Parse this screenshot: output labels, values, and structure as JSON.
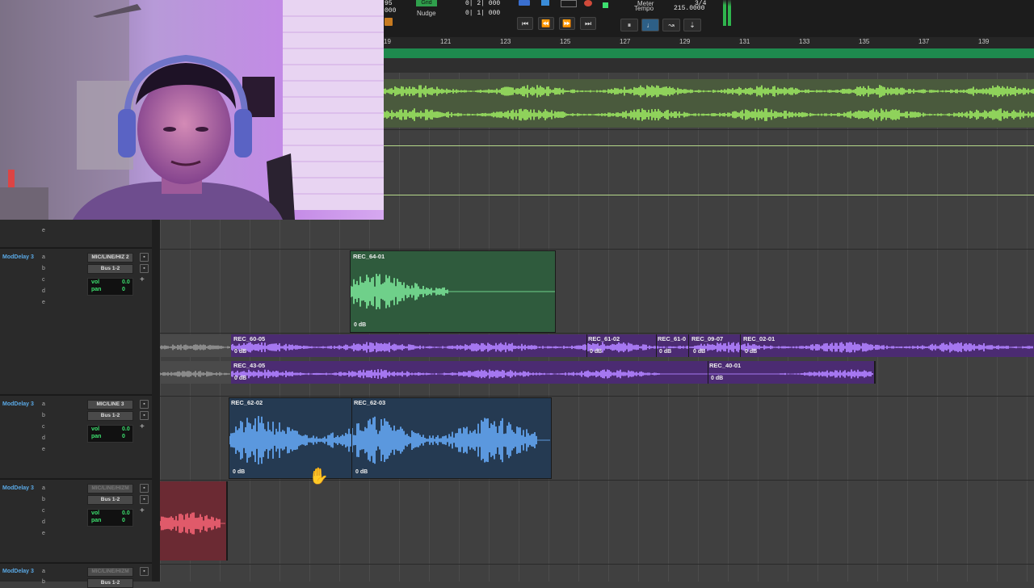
{
  "transport": {
    "counter_top": "95",
    "counter_bottom": "000",
    "grid_label": "Grid",
    "grid_value": "0| 2| 000",
    "nudge_label": "Nudge",
    "nudge_value": "0| 1| 000",
    "meter_label": "Meter",
    "tempo_label": "Tempo",
    "meter_value": "3/4",
    "tempo_value": "215.0000"
  },
  "ruler": {
    "bars": [
      "19",
      "121",
      "123",
      "125",
      "127",
      "129",
      "131",
      "133",
      "135",
      "137",
      "139"
    ]
  },
  "tracks": [
    {
      "name": "ModDelay 3",
      "inserts": [
        "a",
        "b",
        "c",
        "d",
        "e"
      ],
      "input": "MIC/LINE/HIZ 2",
      "output": "Bus 1-2",
      "vol_label": "vol",
      "vol": "0.0",
      "pan_label": "pan",
      "pan": "0"
    },
    {
      "name": "ModDelay 3",
      "inserts": [
        "a",
        "b",
        "c",
        "d",
        "e"
      ],
      "input": "MIC/LINE 3",
      "output": "Bus 1-2",
      "vol_label": "vol",
      "vol": "0.0",
      "pan_label": "pan",
      "pan": "0"
    },
    {
      "name": "ModDelay 3",
      "inserts": [
        "a",
        "b",
        "c",
        "d",
        "e"
      ],
      "input": "MIC/LINE/HIZM",
      "output": "Bus 1-2",
      "vol_label": "vol",
      "vol": "0.0",
      "pan_label": "pan",
      "pan": "0"
    },
    {
      "name": "ModDelay 3",
      "inserts": [
        "a",
        "b"
      ],
      "input": "MIC/LINE/HIZM",
      "output": "Bus 1-2"
    }
  ],
  "partial_track": {
    "insert": "e"
  },
  "clips": {
    "green": {
      "name": "REC_64-01",
      "gain": "0 dB"
    },
    "purple_top": [
      {
        "name": "REC_60-05",
        "gain": "0 dB"
      },
      {
        "name": "REC_61-02",
        "gain": "0 dB"
      },
      {
        "name": "REC_61-0",
        "gain": "0 dB"
      },
      {
        "name": "REC_09-07",
        "gain": "0 dB"
      },
      {
        "name": "REC_02-01",
        "gain": "0 dB"
      }
    ],
    "purple_bottom": [
      {
        "name": "REC_43-05",
        "gain": "0 dB"
      },
      {
        "name": "REC_40-01",
        "gain": "0 dB"
      }
    ],
    "blue": [
      {
        "name": "REC_62-02",
        "gain": "0 dB"
      },
      {
        "name": "REC_62-03",
        "gain": "0 dB"
      }
    ]
  },
  "colors": {
    "track_name": "#5aa9e6",
    "green_clip": "#2f5b3d",
    "green_wave": "#6fd08a",
    "purple_clip": "#4b2b72",
    "purple_wave": "#a577f0",
    "blue_clip": "#253a52",
    "blue_wave": "#5b98de",
    "red_clip": "#6b2a33",
    "red_wave": "#e05a6a",
    "stereo_wave": "#8fd25b",
    "marker": "#1e8a4e"
  },
  "icons": [
    "hand-cursor-icon",
    "plus-icon",
    "dropdown-arrow-icon",
    "rewind-icon",
    "fast-forward-icon",
    "return-to-zero-icon",
    "go-to-end-icon"
  ]
}
